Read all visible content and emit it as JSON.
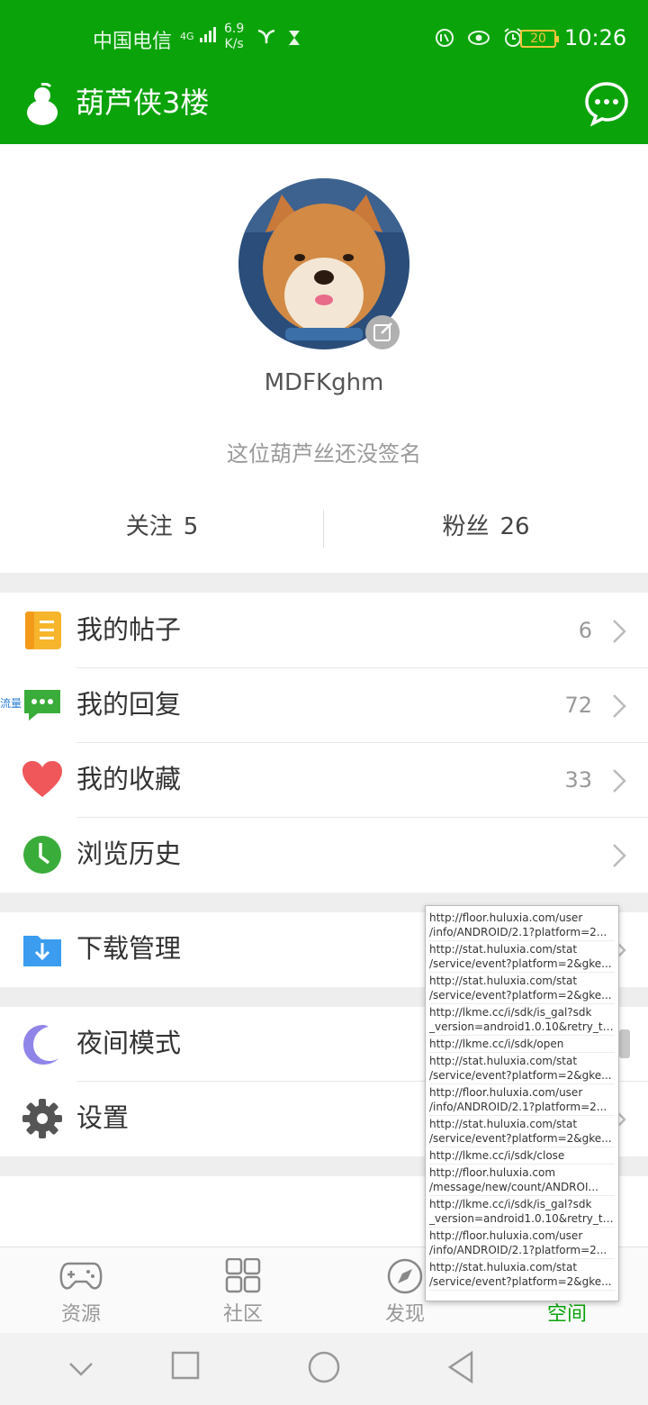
{
  "status_bar": {
    "carrier": "中国电信",
    "network": "4G",
    "speed_value": "6.9",
    "speed_unit": "K/s",
    "battery": "20",
    "time": "10:26"
  },
  "header": {
    "title": "葫芦侠3楼"
  },
  "profile": {
    "username": "MDFKghm",
    "signature": "这位葫芦丝还没签名",
    "following_label": "关注",
    "following_count": "5",
    "fans_label": "粉丝",
    "fans_count": "26"
  },
  "menu": {
    "my_posts": {
      "label": "我的帖子",
      "count": "6",
      "icon": "posts-icon",
      "color": "#f7b52c"
    },
    "my_replies": {
      "label": "我的回复",
      "count": "72",
      "icon": "reply-bubble-icon",
      "color": "#3aac3a"
    },
    "my_favorites": {
      "label": "我的收藏",
      "count": "33",
      "icon": "heart-icon",
      "color": "#f0575a"
    },
    "history": {
      "label": "浏览历史",
      "icon": "clock-icon",
      "color": "#3aac3a"
    },
    "downloads": {
      "label": "下载管理",
      "icon": "download-folder-icon",
      "color": "#3b9cf0"
    },
    "night_mode": {
      "label": "夜间模式",
      "icon": "moon-icon",
      "color": "#8f84e8"
    },
    "settings": {
      "label": "设置",
      "icon": "gear-icon",
      "color": "#555555"
    }
  },
  "floating_tag": "流量",
  "overlay_urls": [
    [
      "http://floor.huluxia.com/user",
      "/info/ANDROID/2.1?platform=2..."
    ],
    [
      "http://stat.huluxia.com/stat",
      "/service/event?platform=2&gke..."
    ],
    [
      "http://stat.huluxia.com/stat",
      "/service/event?platform=2&gke..."
    ],
    [
      "http://lkme.cc/i/sdk/is_gal?sdk",
      "_version=android1.0.10&retry_ti..."
    ],
    [
      "http://lkme.cc/i/sdk/open"
    ],
    [
      "http://stat.huluxia.com/stat",
      "/service/event?platform=2&gke..."
    ],
    [
      "http://floor.huluxia.com/user",
      "/info/ANDROID/2.1?platform=2..."
    ],
    [
      "http://stat.huluxia.com/stat",
      "/service/event?platform=2&gke..."
    ],
    [
      "http://lkme.cc/i/sdk/close"
    ],
    [
      "http://floor.huluxia.com",
      "/message/new/count/ANDROI..."
    ],
    [
      "http://lkme.cc/i/sdk/is_gal?sdk",
      "_version=android1.0.10&retry_ti..."
    ],
    [
      "http://floor.huluxia.com/user",
      "/info/ANDROID/2.1?platform=2..."
    ],
    [
      "http://stat.huluxia.com/stat",
      "/service/event?platform=2&gke..."
    ]
  ],
  "bottom_nav": {
    "tabs": [
      {
        "label": "资源",
        "icon": "gamepad-icon"
      },
      {
        "label": "社区",
        "icon": "grid-icon"
      },
      {
        "label": "发现",
        "icon": "compass-icon"
      },
      {
        "label": "空间",
        "icon": "person-icon",
        "active": true
      }
    ]
  },
  "theme": {
    "primary": "#0aa30a"
  }
}
